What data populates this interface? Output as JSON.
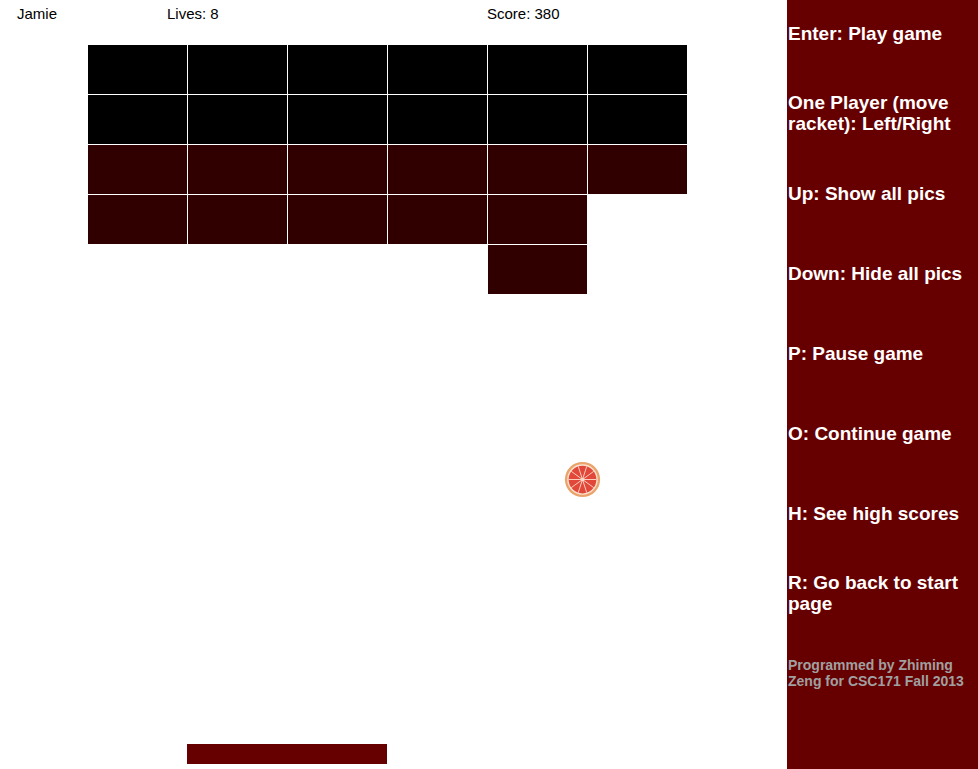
{
  "player": {
    "name": "Jamie",
    "lives": "Lives: 8",
    "score": "Score: 380"
  },
  "bricks": [
    [
      {
        "present": true,
        "color": "#000000"
      },
      {
        "present": true,
        "color": "#000000"
      },
      {
        "present": true,
        "color": "#000000"
      },
      {
        "present": true,
        "color": "#000000"
      },
      {
        "present": true,
        "color": "#000000"
      },
      {
        "present": true,
        "color": "#000000"
      }
    ],
    [
      {
        "present": true,
        "color": "#000000"
      },
      {
        "present": true,
        "color": "#000000"
      },
      {
        "present": true,
        "color": "#000000"
      },
      {
        "present": true,
        "color": "#000000"
      },
      {
        "present": true,
        "color": "#000000"
      },
      {
        "present": true,
        "color": "#000000"
      }
    ],
    [
      {
        "present": true,
        "color": "#300000"
      },
      {
        "present": true,
        "color": "#300000"
      },
      {
        "present": true,
        "color": "#300000"
      },
      {
        "present": true,
        "color": "#300000"
      },
      {
        "present": true,
        "color": "#300000"
      },
      {
        "present": true,
        "color": "#300000"
      }
    ],
    [
      {
        "present": true,
        "color": "#300000"
      },
      {
        "present": true,
        "color": "#300000"
      },
      {
        "present": true,
        "color": "#300000"
      },
      {
        "present": true,
        "color": "#300000"
      },
      {
        "present": true,
        "color": "#300000"
      },
      {
        "present": false
      }
    ],
    [
      {
        "present": false
      },
      {
        "present": false
      },
      {
        "present": false
      },
      {
        "present": false
      },
      {
        "present": true,
        "color": "#300000"
      },
      {
        "present": false
      }
    ]
  ],
  "help": [
    "Enter: Play game",
    "One Player (move racket): Left/Right",
    "Up: Show all pics",
    "Down: Hide all pics",
    "P: Pause game",
    "O: Continue game",
    "H: See high scores",
    "R: Go back to start page"
  ],
  "credit": "Programmed by Zhiming Zeng for CSC171 Fall 2013"
}
